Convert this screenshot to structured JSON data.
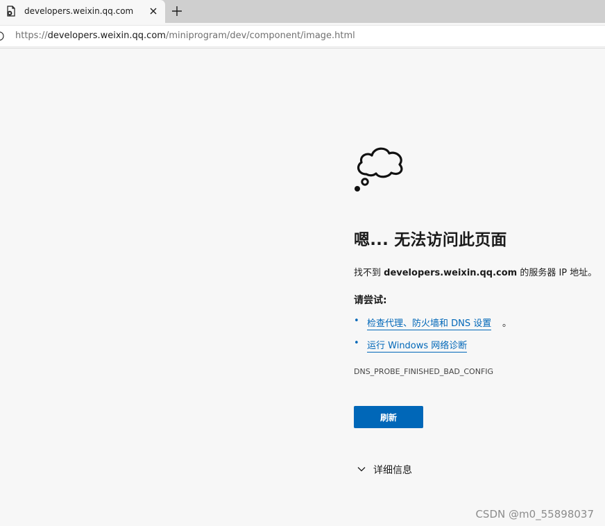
{
  "browser": {
    "tab": {
      "title": "developers.weixin.qq.com",
      "favicon": "error-page-icon",
      "close_icon": "close-icon"
    },
    "new_tab_icon": "plus-icon",
    "address": {
      "scheme": "https://",
      "host": "developers.weixin.qq.com",
      "path": "/miniprogram/dev/component/image.html",
      "info_icon": "info-icon"
    }
  },
  "error_page": {
    "icon": "thought-cloud-icon",
    "title": "嗯... 无法访问此页面",
    "desc_prefix": "找不到 ",
    "desc_host": "developers.weixin.qq.com",
    "desc_suffix": " 的服务器 IP 地址。",
    "try_label": "请尝试:",
    "suggestions": [
      {
        "bullet": "•",
        "link": "检查代理、防火墙和 DNS 设置",
        "tail": "。"
      },
      {
        "bullet": "•",
        "link": "运行 Windows 网络诊断",
        "tail": ""
      }
    ],
    "error_code": "DNS_PROBE_FINISHED_BAD_CONFIG",
    "refresh_label": "刷新",
    "details_label": "详细信息",
    "details_icon": "chevron-down-icon"
  },
  "watermark": "CSDN @m0_55898037",
  "colors": {
    "accent": "#0067b8",
    "page_background": "#f7f7f7",
    "tabstrip": "#cfcfcf"
  }
}
